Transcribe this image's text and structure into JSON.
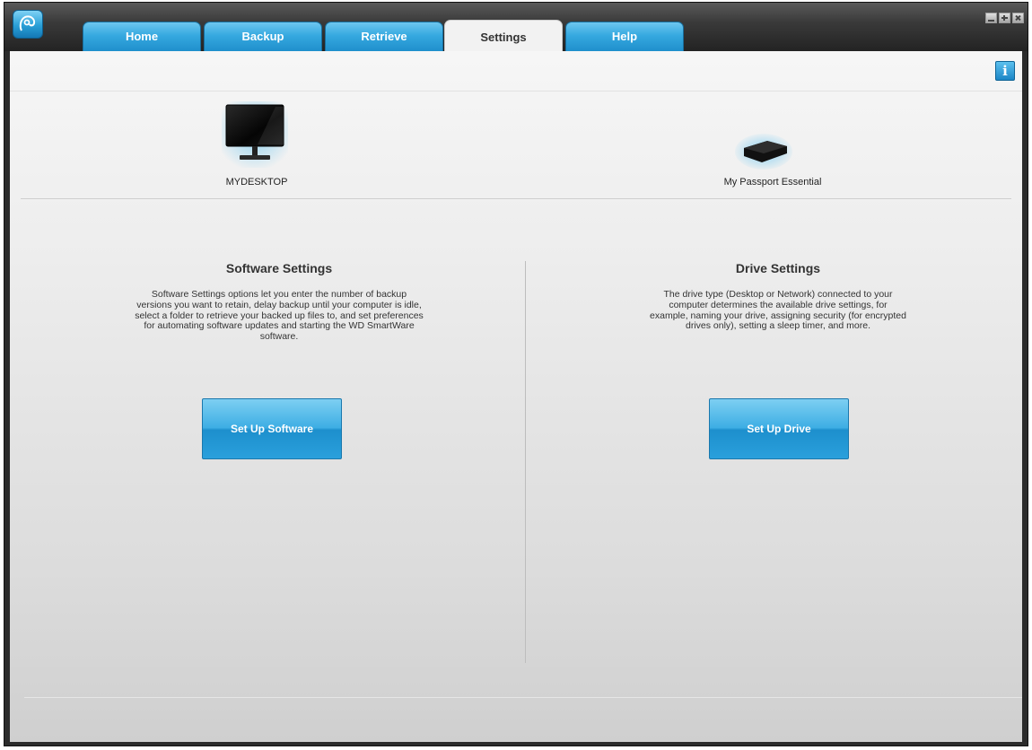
{
  "tabs": [
    {
      "label": "Home"
    },
    {
      "label": "Backup"
    },
    {
      "label": "Retrieve"
    },
    {
      "label": "Settings"
    },
    {
      "label": "Help"
    }
  ],
  "active_tab": "Settings",
  "devices": {
    "computer": {
      "label": "MYDESKTOP",
      "icon": "desktop-monitor-icon"
    },
    "drive": {
      "label": "My Passport Essential",
      "icon": "external-drive-icon"
    }
  },
  "software_settings": {
    "title": "Software Settings",
    "description": "Software Settings options let you enter the number of backup versions you want to retain, delay backup until your computer is idle, select a folder to retrieve your backed up files to, and set preferences for automating software updates and starting the WD SmartWare software.",
    "button_label": "Set Up Software"
  },
  "drive_settings": {
    "title": "Drive Settings",
    "description": "The drive type (Desktop or Network) connected to your computer determines the available drive settings, for example, naming your drive, assigning security (for encrypted drives only), setting a sleep timer, and more.",
    "button_label": "Set Up Drive"
  },
  "info_button_label": "i",
  "colors": {
    "accent": "#2aa0dc",
    "tab_dark": "#1f8fcc"
  }
}
